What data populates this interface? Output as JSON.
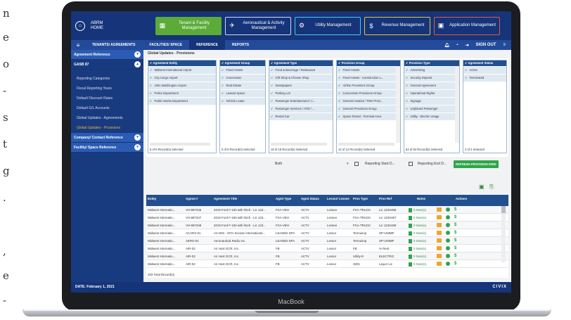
{
  "side_letters": [
    "n",
    "e",
    "o",
    "-",
    "s",
    "t",
    "g",
    ".",
    ",",
    "e",
    "-"
  ],
  "app": {
    "logo_line1": "ABRM",
    "logo_line2": "HOME"
  },
  "modules": [
    {
      "icon": "▦",
      "label": "Tenant & Facility Management"
    },
    {
      "icon": "✈",
      "label": "Aeronautical & Activity Management"
    },
    {
      "icon": "⚙",
      "label": "Utility Management"
    },
    {
      "icon": "$",
      "label": "Revenue Management"
    },
    {
      "icon": "▣",
      "label": "Application Management"
    }
  ],
  "nav": {
    "tabs": [
      "TENANTS/ AGREEMENTS",
      "FACILITIES/ SPACE",
      "REFERENCE",
      "REPORTS"
    ],
    "sign_out": "SIGN OUT"
  },
  "sidebar": {
    "sections": [
      {
        "label": "Agreement Reference"
      },
      {
        "label": "GASB 87"
      }
    ],
    "items": [
      "Reporting Categories",
      "Fiscal Reporting Years",
      "Default Discount Rates",
      "Default G/L Accounts",
      "Global Updates - Agreements",
      "Global Updates - Provisions"
    ],
    "sections2": [
      {
        "label": "Company/ Contact Reference"
      },
      {
        "label": "Facility/ Space Reference"
      }
    ]
  },
  "breadcrumb": "Global Updates - Provisions",
  "panels": [
    {
      "header": "Agreement Entity",
      "rows": [
        "Midwest International Airport",
        "City Cargo Airport",
        "John Washington Airport",
        "Police Department",
        "Public Works Department"
      ],
      "count": "5 of 5 Record(s) Selected"
    },
    {
      "header": "Agreement Group",
      "rows": [
        "Fixed Assets",
        "Concession",
        "Real Estate",
        "Leased Space",
        "Vehicle Lease"
      ],
      "count": "5 of 5 Record(s) Selected"
    },
    {
      "header": "Agreement Type",
      "rows": [
        "Food & Beverage / Restaurant",
        "Gift Shop & Cheese Shop",
        "Newspapers",
        "Parking Lot",
        "Passenger Entertainment / A...",
        "Passenger Services / ATM / ...",
        "Rental Car"
      ],
      "count": "16 of 16 Record(s) Selected"
    },
    {
      "header": "Provision Group",
      "rows": [
        "Fixed Assets",
        "Fixed Assets - Construction L...",
        "Airline Provisions Group",
        "Concession Provisions Group",
        "General Aviation / FBO Provi...",
        "General Provisions Group",
        "Space Rental - Terminal Area"
      ],
      "count": "12 of 12 Record(s) Selected"
    },
    {
      "header": "Provision Type",
      "rows": [
        "Advertising",
        "Security Deposit",
        "General Agreement",
        "Operational Rights",
        "Signage",
        "Unplaned Passenger",
        "Utility - Electric Usage"
      ],
      "count": "84 of 84 Record(s) Selected"
    },
    {
      "header": "Agreement Status",
      "rows": [
        "Active",
        "Terminated"
      ],
      "count": "2 of 2 Selected"
    }
  ],
  "filters": {
    "both": "Both",
    "start": "Reporting Start D...",
    "end": "Reporting End D...",
    "refresh": "REFRESH PROVISION GRID"
  },
  "grid": {
    "headers": [
      "Entity",
      "Agmnt #",
      "Agreement Title",
      "Agmt Type",
      "Agmt Status",
      "Lessor/ Lessee",
      "Prov Type",
      "Prov Ref",
      "Notes",
      "Actions"
    ],
    "rows": [
      [
        "Midwest Internatio...",
        "VH-987345",
        "2019 Ford F-150 with hitch - Lic 123...",
        "FXA-VEH",
        "ACTV",
        "Lessee",
        "FXA-TRUCK",
        "Lic 123X456",
        "0 Note(s)"
      ],
      [
        "Midwest Internatio...",
        "VH-987347",
        "2019 Ford F-150 with hitch - Lic 123...",
        "FXA-VEH",
        "ACTV",
        "Lessee",
        "FXA-TRUCK",
        "Lic 123X457",
        "0 Note(s)"
      ],
      [
        "Midwest Internatio...",
        "VH-987348",
        "2019 Ford F-150 with hitch - Lic 123...",
        "FXA-VEH",
        "ACTV",
        "Lessee",
        "FXA-TRUCK",
        "Lic 123X458",
        "0 Note(s)"
      ],
      [
        "Midwest Internatio...",
        "ACARS-01",
        "ACARS - SITA Societe International...",
        "LEASED SPA",
        "ACTV",
        "Lessor",
        "Termuimp",
        "SP-UNIMP",
        "0 Note(s)"
      ],
      [
        "Midwest Internatio...",
        "AERO-01",
        "Aeronautical Radio Inc.",
        "LEASED SPA",
        "ACTV",
        "Lessor",
        "Termuimp",
        "SP-UNIMP",
        "0 Note(s)"
      ],
      [
        "Midwest Internatio...",
        "AIR-02",
        "Air Host GCR, Inc.",
        "FB",
        "ACTV",
        "Lessor",
        "FB",
        "% Rent",
        "0 Note(s)"
      ],
      [
        "Midwest Internatio...",
        "AIR-02",
        "Air Host GCR, Inc.",
        "FB",
        "ACTV",
        "Lessor",
        "Utility-E",
        "ELECTRIC",
        "0 Note(s)"
      ],
      [
        "Midwest Internatio...",
        "AIR-02",
        "Air Host GCR, Inc.",
        "FB",
        "ACTV",
        "Lessor",
        "GEN",
        "Liquor Lic",
        "0 Note(s)"
      ]
    ],
    "total": "203 Total Record(s)"
  },
  "footer": {
    "date": "DATE: February 1, 2021",
    "brand": "CIVIX"
  },
  "laptop": "MacBook"
}
